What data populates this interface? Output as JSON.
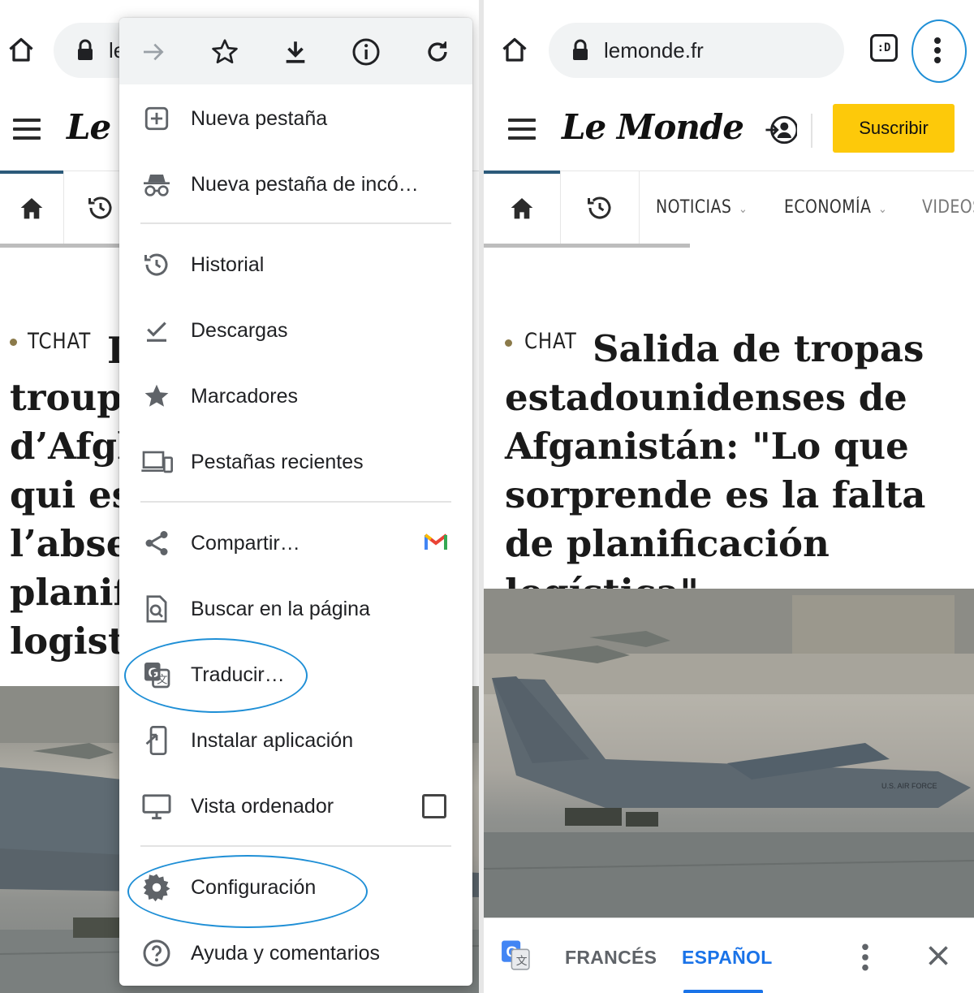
{
  "left_panel": {
    "url": "le",
    "logo": "Le M",
    "kicker": "TCHAT",
    "headline_lines": [
      "troup",
      "d’Afgh",
      "qui es",
      "l’abse",
      "planif",
      "logist"
    ]
  },
  "overflow_menu": {
    "top_icons": [
      "forward-arrow-icon",
      "star-icon",
      "download-icon",
      "info-icon",
      "reload-icon"
    ],
    "items": {
      "new_tab": "Nueva pestaña",
      "incognito": "Nueva pestaña de incó…",
      "history": "Historial",
      "downloads": "Descargas",
      "bookmarks": "Marcadores",
      "recent_tabs": "Pestañas recientes",
      "share": "Compartir…",
      "find": "Buscar en la página",
      "translate": "Traducir…",
      "install": "Instalar aplicación",
      "desktop": "Vista ordenador",
      "settings": "Configuración",
      "help": "Ayuda y comentarios"
    },
    "desktop_checked": false
  },
  "right_panel": {
    "url": "lemonde.fr",
    "tabs_badge": ":D",
    "logo": "Le Monde",
    "subscribe": "Suscribir",
    "nav": [
      "NOTICIAS",
      "ECONOMÍA",
      "VIDEOS"
    ],
    "kicker": "CHAT",
    "headline": "Salida de tropas estadounidenses de Afganistán: \"Lo que sorprende es la falta de planificación logística\"",
    "photo_text": "U.S. AIR FORCE",
    "translate_bar": {
      "source_lang": "FRANCÉS",
      "target_lang": "ESPAÑOL"
    }
  },
  "colors": {
    "accent_blue": "#1a73e8",
    "highlight_oval": "#1f8fd6",
    "subscribe_yellow": "#fdc90a",
    "nav_active": "#2c5a7a"
  }
}
